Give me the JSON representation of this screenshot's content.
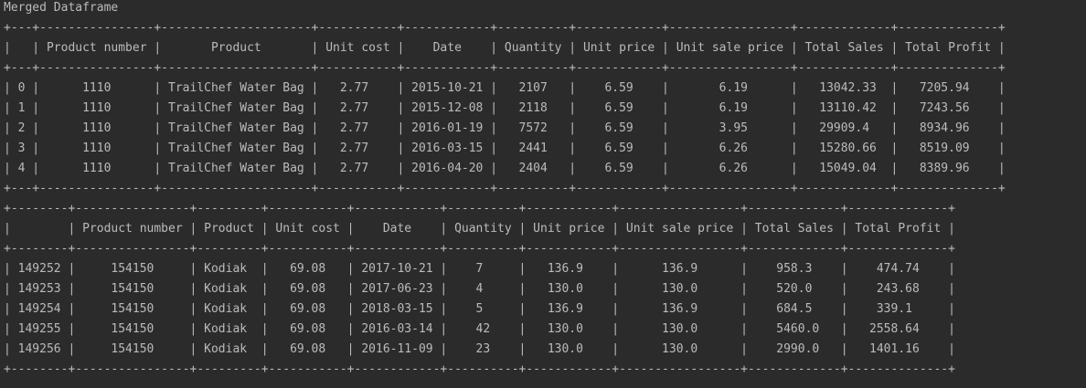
{
  "console": {
    "title": "Merged Dataframe",
    "table1": {
      "border": "+---+----------------+---------------------+-----------+------------+----------+------------+-----------------+-------------+--------------+",
      "header": "|   | Product number |       Product       | Unit cost |    Date    | Quantity | Unit price | Unit sale price | Total Sales | Total Profit |",
      "rows": [
        "| 0 |      1110      | TrailChef Water Bag |   2.77    | 2015-10-21 |   2107   |    6.59    |       6.19      |   13042.33  |   7205.94    |",
        "| 1 |      1110      | TrailChef Water Bag |   2.77    | 2015-12-08 |   2118   |    6.59    |       6.19      |   13110.42  |   7243.56    |",
        "| 2 |      1110      | TrailChef Water Bag |   2.77    | 2016-01-19 |   7572   |    6.59    |       3.95      |   29909.4   |   8934.96    |",
        "| 3 |      1110      | TrailChef Water Bag |   2.77    | 2016-03-15 |   2441   |    6.59    |       6.26      |   15280.66  |   8519.09    |",
        "| 4 |      1110      | TrailChef Water Bag |   2.77    | 2016-04-20 |   2404   |    6.59    |       6.26      |   15049.04  |   8389.96    |"
      ]
    },
    "table2": {
      "border": "+--------+----------------+---------+-----------+------------+----------+------------+-----------------+-------------+--------------+",
      "header": "|        | Product number | Product | Unit cost |    Date    | Quantity | Unit price | Unit sale price | Total Sales | Total Profit |",
      "rows": [
        "| 149252 |     154150     | Kodiak  |   69.08   | 2017-10-21 |    7     |   136.9    |      136.9      |    958.3    |    474.74    |",
        "| 149253 |     154150     | Kodiak  |   69.08   | 2017-06-23 |    4     |   130.0    |      130.0      |    520.0    |    243.68    |",
        "| 149254 |     154150     | Kodiak  |   69.08   | 2018-03-15 |    5     |   136.9    |      136.9      |    684.5    |    339.1     |",
        "| 149255 |     154150     | Kodiak  |   69.08   | 2016-03-14 |    42    |   130.0    |      130.0      |    5460.0   |   2558.64    |",
        "| 149256 |     154150     | Kodiak  |   69.08   | 2016-11-09 |    23    |   130.0    |      130.0      |    2990.0   |   1401.16    |"
      ]
    }
  }
}
